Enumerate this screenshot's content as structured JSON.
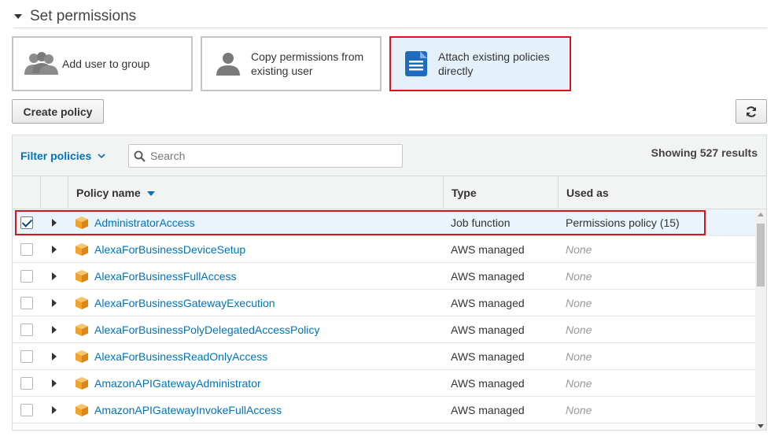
{
  "section": {
    "title": "Set permissions",
    "expanded": true
  },
  "options": [
    {
      "label_line1": "Add user to group",
      "label_line2": "",
      "icon": "users-group-icon",
      "selected": false
    },
    {
      "label_line1": "Copy permissions from",
      "label_line2": "existing user",
      "icon": "user-icon",
      "selected": false
    },
    {
      "label_line1": "Attach existing policies",
      "label_line2": "directly",
      "icon": "document-icon",
      "selected": true
    }
  ],
  "toolbar": {
    "create_policy_label": "Create policy",
    "refresh_icon": "refresh-icon"
  },
  "filter": {
    "label": "Filter policies",
    "search_placeholder": "Search",
    "search_value": "",
    "results_text": "Showing 527 results"
  },
  "columns": {
    "policy_name": "Policy name",
    "type": "Type",
    "used_as": "Used as"
  },
  "rows": [
    {
      "name": "AdministratorAccess",
      "type": "Job function",
      "used_as": "Permissions policy (15)",
      "checked": true
    },
    {
      "name": "AlexaForBusinessDeviceSetup",
      "type": "AWS managed",
      "used_as": "None",
      "checked": false
    },
    {
      "name": "AlexaForBusinessFullAccess",
      "type": "AWS managed",
      "used_as": "None",
      "checked": false
    },
    {
      "name": "AlexaForBusinessGatewayExecution",
      "type": "AWS managed",
      "used_as": "None",
      "checked": false
    },
    {
      "name": "AlexaForBusinessPolyDelegatedAccessPolicy",
      "type": "AWS managed",
      "used_as": "None",
      "checked": false
    },
    {
      "name": "AlexaForBusinessReadOnlyAccess",
      "type": "AWS managed",
      "used_as": "None",
      "checked": false
    },
    {
      "name": "AmazonAPIGatewayAdministrator",
      "type": "AWS managed",
      "used_as": "None",
      "checked": false
    },
    {
      "name": "AmazonAPIGatewayInvokeFullAccess",
      "type": "AWS managed",
      "used_as": "None",
      "checked": false
    }
  ],
  "colors": {
    "link": "#0073bb",
    "highlight": "#d9141d",
    "policy_icon": "#f0a42a",
    "selected_bg": "#e4f1fb"
  }
}
